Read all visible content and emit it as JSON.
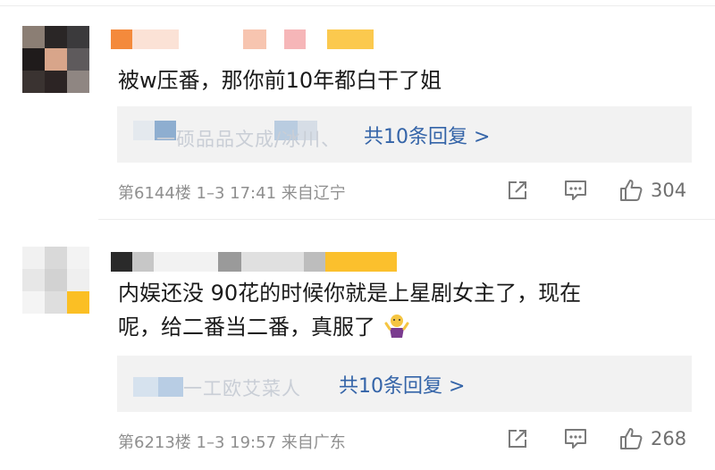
{
  "comments": [
    {
      "content": "被w压番，那你前10年都白干了姐",
      "reply_faint": "一硕品品文成/冰川、",
      "reply_link": "共10条回复 >",
      "meta": "第6144楼 1–3 17:41 来自辽宁",
      "likes": "304"
    },
    {
      "content_line1": "内娱还没 90花的时候你就是上星剧女主了，现在",
      "content_line2": "呢，给二番当二番，真服了",
      "emoji": "shrug-emoji",
      "reply_faint": "一工欧艾菜人",
      "reply_link": "共10条回复 >",
      "meta": "第6213楼 1–3 19:57 来自广东",
      "likes": "268"
    }
  ],
  "icons": {
    "share": "share-icon",
    "comment": "comment-icon",
    "like": "thumbs-up-icon"
  },
  "colors": {
    "link": "#3464a8",
    "meta": "#8f8f8f",
    "reply_bg": "#f2f2f2"
  }
}
